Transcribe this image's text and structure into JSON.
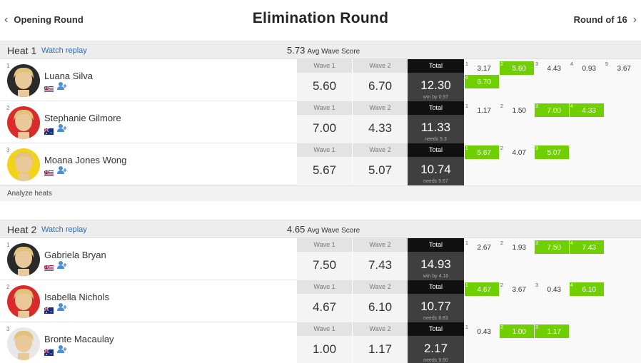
{
  "nav": {
    "prev_label": "Opening Round",
    "next_label": "Round of 16",
    "title": "Elimination Round"
  },
  "labels": {
    "watch_replay": "Watch replay",
    "avg_label": "Avg Wave Score",
    "wave1": "Wave 1",
    "wave2": "Wave 2",
    "total": "Total",
    "analyze": "Analyze heats"
  },
  "colors": {
    "highlight": "#6fcf00",
    "total_bg": "#3f3f3f",
    "total_header": "#111111",
    "link": "#2a6db0"
  },
  "heats": [
    {
      "title": "Heat 1",
      "avg": "5.73",
      "surfers": [
        {
          "seed": "1",
          "name": "Luana Silva",
          "flag": "hawaii",
          "avatar_color": "#2a2a2a",
          "wave1": "5.60",
          "wave2": "6.70",
          "total": "12.30",
          "note": "win by 0.97",
          "waves": [
            {
              "n": "1",
              "v": "3.17",
              "hi": false
            },
            {
              "n": "2",
              "v": "5.60",
              "hi": true
            },
            {
              "n": "3",
              "v": "4.43",
              "hi": false
            },
            {
              "n": "4",
              "v": "0.93",
              "hi": false
            },
            {
              "n": "5",
              "v": "3.67",
              "hi": false
            },
            {
              "n": "6",
              "v": "6.70",
              "hi": true
            }
          ]
        },
        {
          "seed": "2",
          "name": "Stephanie Gilmore",
          "flag": "australia",
          "avatar_color": "#d92b2b",
          "wave1": "7.00",
          "wave2": "4.33",
          "total": "11.33",
          "note": "needs 5.3",
          "waves": [
            {
              "n": "1",
              "v": "1.17",
              "hi": false
            },
            {
              "n": "2",
              "v": "1.50",
              "hi": false
            },
            {
              "n": "3",
              "v": "7.00",
              "hi": true
            },
            {
              "n": "4",
              "v": "4.33",
              "hi": true
            }
          ]
        },
        {
          "seed": "3",
          "name": "Moana Jones Wong",
          "flag": "hawaii",
          "avatar_color": "#f2d21a",
          "wave1": "5.67",
          "wave2": "5.07",
          "total": "10.74",
          "note": "needs 5.67",
          "waves": [
            {
              "n": "1",
              "v": "5.67",
              "hi": true
            },
            {
              "n": "2",
              "v": "4.07",
              "hi": false
            },
            {
              "n": "3",
              "v": "5.07",
              "hi": true
            }
          ]
        }
      ]
    },
    {
      "title": "Heat 2",
      "avg": "4.65",
      "surfers": [
        {
          "seed": "1",
          "name": "Gabriela Bryan",
          "flag": "hawaii",
          "avatar_color": "#2a2a2a",
          "wave1": "7.50",
          "wave2": "7.43",
          "total": "14.93",
          "note": "win by 4.16",
          "waves": [
            {
              "n": "1",
              "v": "2.67",
              "hi": false
            },
            {
              "n": "2",
              "v": "1.93",
              "hi": false
            },
            {
              "n": "3",
              "v": "7.50",
              "hi": true
            },
            {
              "n": "4",
              "v": "7.43",
              "hi": true
            }
          ]
        },
        {
          "seed": "2",
          "name": "Isabella Nichols",
          "flag": "australia",
          "avatar_color": "#d92b2b",
          "wave1": "4.67",
          "wave2": "6.10",
          "total": "10.77",
          "note": "needs 8.83",
          "waves": [
            {
              "n": "1",
              "v": "4.67",
              "hi": true
            },
            {
              "n": "2",
              "v": "3.67",
              "hi": false
            },
            {
              "n": "3",
              "v": "0.43",
              "hi": false
            },
            {
              "n": "4",
              "v": "6.10",
              "hi": true
            }
          ]
        },
        {
          "seed": "3",
          "name": "Bronte Macaulay",
          "flag": "australia",
          "avatar_color": "#e8e8e8",
          "wave1": "1.00",
          "wave2": "1.17",
          "total": "2.17",
          "note": "needs 9.60",
          "waves": [
            {
              "n": "1",
              "v": "0.43",
              "hi": false
            },
            {
              "n": "2",
              "v": "1.00",
              "hi": true
            },
            {
              "n": "3",
              "v": "1.17",
              "hi": true
            }
          ]
        }
      ]
    }
  ]
}
